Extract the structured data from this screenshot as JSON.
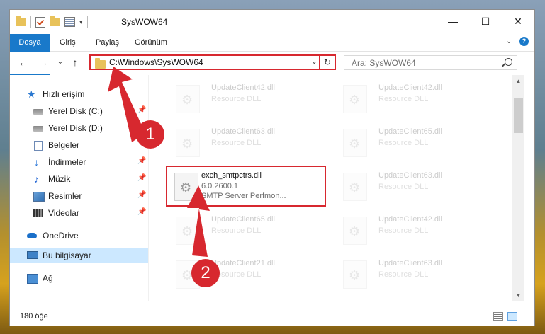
{
  "window": {
    "title": "SysWOW64",
    "controls": {
      "minimize": "—",
      "maximize": "☐",
      "close": "✕"
    }
  },
  "ribbon": {
    "tabs": [
      "Dosya",
      "Giriş",
      "Paylaş",
      "Görünüm"
    ],
    "expand": "⌄",
    "help": "?"
  },
  "nav": {
    "back": "←",
    "forward": "→",
    "recent": "⌄",
    "up": "↑",
    "address": "C:\\Windows\\SysWOW64",
    "address_drop": "⌄",
    "refresh": "↻",
    "search_placeholder": "Ara: SysWOW64"
  },
  "sidebar": {
    "items": [
      {
        "label": "Hızlı erişim",
        "icon": "star-icon"
      },
      {
        "label": "Yerel Disk (C:)",
        "icon": "drive-icon"
      },
      {
        "label": "Yerel Disk (D:)",
        "icon": "drive-icon"
      },
      {
        "label": "Belgeler",
        "icon": "documents-icon"
      },
      {
        "label": "İndirmeler",
        "icon": "download-icon"
      },
      {
        "label": "Müzik",
        "icon": "music-icon"
      },
      {
        "label": "Resimler",
        "icon": "pictures-icon"
      },
      {
        "label": "Videolar",
        "icon": "videos-icon"
      },
      {
        "label": "OneDrive",
        "icon": "cloud-icon"
      },
      {
        "label": "Bu bilgisayar",
        "icon": "computer-icon"
      },
      {
        "label": "Ağ",
        "icon": "network-icon"
      }
    ]
  },
  "files": {
    "highlighted": {
      "name": "exch_smtpctrs.dll",
      "version": "6.0.2600.1",
      "description": "SMTP Server Perfmon..."
    },
    "background": [
      {
        "name": "UpdateClient42.dll",
        "desc": "Resource DLL"
      },
      {
        "name": "UpdateClient42.dll",
        "desc": "Resource DLL"
      },
      {
        "name": "UpdateClient63.dll",
        "desc": "Resource DLL"
      },
      {
        "name": "UpdateClient65.dll",
        "desc": "Resource DLL"
      },
      {
        "name": "UpdateClient63.dll",
        "desc": "Resource DLL"
      },
      {
        "name": "UpdateClient65.dll",
        "desc": "Resource DLL"
      },
      {
        "name": "UpdateClient42.dll",
        "desc": "Resource DLL"
      },
      {
        "name": "UpdateClient21.dll",
        "desc": "Resource DLL"
      },
      {
        "name": "UpdateClient63.dll",
        "desc": "Resource DLL"
      }
    ]
  },
  "status": {
    "count": "180 öğe"
  },
  "annotations": {
    "step1": "1",
    "step2": "2"
  },
  "colors": {
    "accent": "#1979ca",
    "highlight": "#d7282f",
    "selection": "#cce8ff"
  }
}
